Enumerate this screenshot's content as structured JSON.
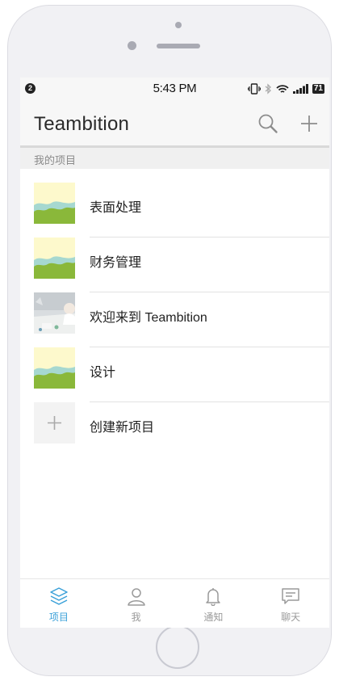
{
  "status_bar": {
    "notification_count": "2",
    "time": "5:43 PM",
    "battery": "71"
  },
  "header": {
    "title": "Teambition",
    "search_icon": "search-icon",
    "add_icon": "plus-icon"
  },
  "section": {
    "title": "我的项目"
  },
  "projects": [
    {
      "name": "表面处理",
      "thumb": "landscape"
    },
    {
      "name": "财务管理",
      "thumb": "landscape"
    },
    {
      "name": "欢迎来到 Teambition",
      "thumb": "photo"
    },
    {
      "name": "设计",
      "thumb": "landscape"
    }
  ],
  "create_project": {
    "label": "创建新项目"
  },
  "tabs": [
    {
      "label": "项目",
      "icon": "layers-icon",
      "active": true
    },
    {
      "label": "我",
      "icon": "person-icon",
      "active": false
    },
    {
      "label": "通知",
      "icon": "bell-icon",
      "active": false
    },
    {
      "label": "聊天",
      "icon": "chat-icon",
      "active": false
    }
  ],
  "colors": {
    "accent": "#3aa0d8",
    "thumb_sky": "#fdf9cc",
    "thumb_teal": "#a6d8d0",
    "thumb_green": "#8ab83a"
  }
}
